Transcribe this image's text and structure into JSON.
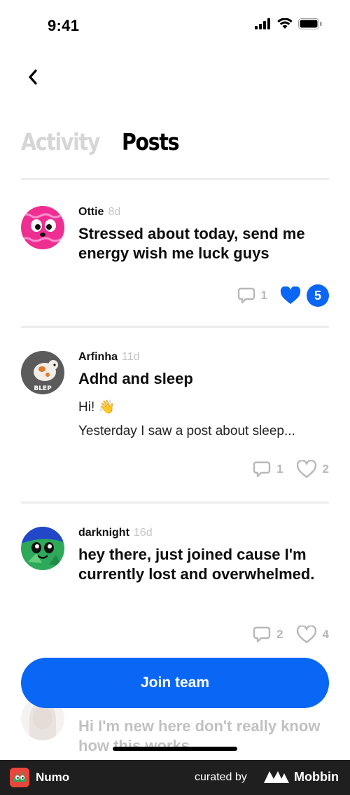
{
  "status_bar": {
    "time": "9:41"
  },
  "navigation": {
    "back_icon": "chevron-left-icon"
  },
  "tabs": [
    {
      "label": "Activity",
      "active": false
    },
    {
      "label": "Posts",
      "active": true
    }
  ],
  "posts": [
    {
      "author": "Ottie",
      "age": "8d",
      "title": "Stressed about today, send me energy wish me luck guys",
      "text_lines": [],
      "comments": "1",
      "likes": "5",
      "liked": true
    },
    {
      "author": "Arfinha",
      "age": "11d",
      "title": "Adhd and sleep",
      "text_lines": [
        "Hi! 👋",
        "Yesterday I saw a post about sleep..."
      ],
      "comments": "1",
      "likes": "2",
      "liked": false
    },
    {
      "author": "darknight",
      "age": "16d",
      "title": "hey there, just joined cause I'm currently lost and overwhelmed.",
      "text_lines": [],
      "comments": "2",
      "likes": "4",
      "liked": false
    },
    {
      "author": "",
      "age": "",
      "title": "Hi I'm new here don't really know how this works",
      "text_lines": [],
      "comments": "",
      "likes": "",
      "liked": false
    }
  ],
  "join_button": {
    "label": "Join team"
  },
  "footer": {
    "app_name": "Numo",
    "curated_by": "curated by",
    "brand": "Mobbin"
  },
  "colors": {
    "accent": "#0a66f4",
    "inactive_tab": "#d6d6d6",
    "muted": "#b8b8b8",
    "footer_bg": "#1f1f1f"
  }
}
